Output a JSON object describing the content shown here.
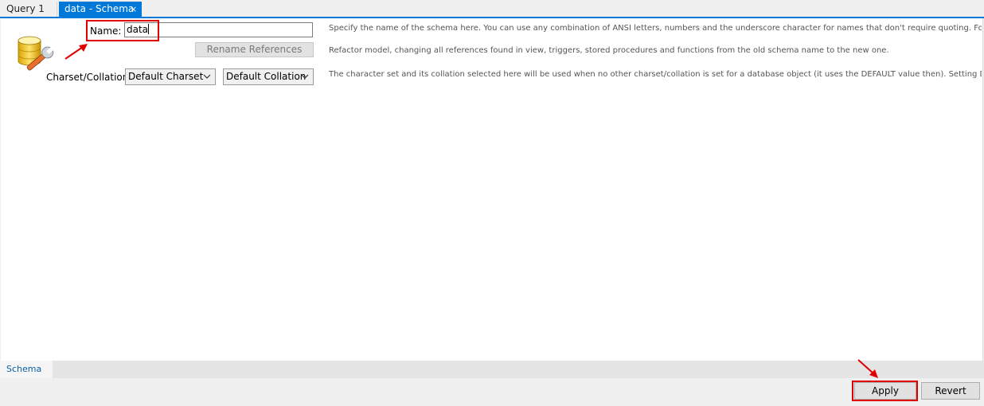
{
  "tabs": {
    "query_tab": "Query 1",
    "active_tab": "data - Schema",
    "close_glyph": "×"
  },
  "form": {
    "name_label": "Name:",
    "name_value": "data",
    "rename_button": "Rename References",
    "charset_label": "Charset/Collation:",
    "charset_value": "Default Charset",
    "collation_value": "Default Collation"
  },
  "descriptions": {
    "name": "Specify the name of the schema here. You can use any combination of ANSI letters, numbers and the underscore character for names that don't require quoting. For more flexibility yo",
    "rename": "Refactor model, changing all references found in view, triggers, stored procedures and functions from the old schema name to the new one.",
    "charset": "The character set and its collation selected here will be used when no other charset/collation is set for a database object (it uses the DEFAULT value then). Setting DEFAULT here will ma"
  },
  "bottom_tabs": {
    "schema_tab": "Schema"
  },
  "footer": {
    "apply": "Apply",
    "revert": "Revert"
  },
  "icons": {
    "database": "database-wrench-icon",
    "dropdown": "chevron-down-icon",
    "close": "close-icon"
  },
  "colors": {
    "accent": "#0078d7",
    "highlight": "#e00000"
  }
}
